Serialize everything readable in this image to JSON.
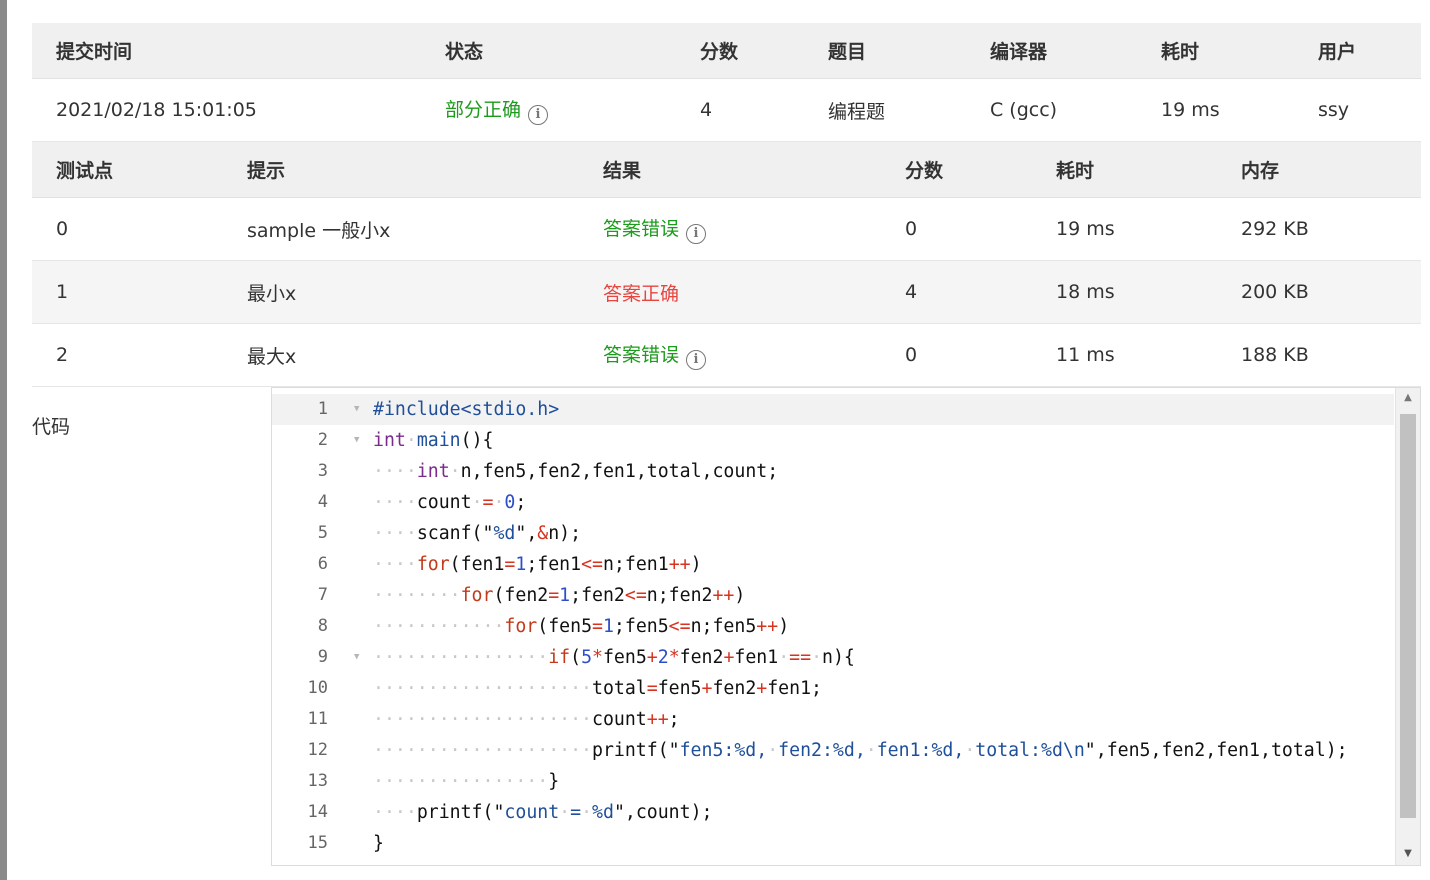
{
  "submission": {
    "headers": [
      "提交时间",
      "状态",
      "分数",
      "题目",
      "编译器",
      "耗时",
      "用户"
    ],
    "row": {
      "time": "2021/02/18 15:01:05",
      "status": "部分正确",
      "score": "4",
      "problem": "编程题",
      "compiler": "C (gcc)",
      "elapsed": "19 ms",
      "user": "ssy"
    }
  },
  "testcases": {
    "headers": [
      "测试点",
      "提示",
      "结果",
      "分数",
      "耗时",
      "内存"
    ],
    "rows": [
      {
        "id": "0",
        "hint": "sample 一般小x",
        "result": "答案错误",
        "score": "0",
        "time": "19 ms",
        "memory": "292 KB"
      },
      {
        "id": "1",
        "hint": "最小x",
        "result": "答案正确",
        "score": "4",
        "time": "18 ms",
        "memory": "200 KB"
      },
      {
        "id": "2",
        "hint": "最大x",
        "result": "答案错误",
        "score": "0",
        "time": "11 ms",
        "memory": "188 KB"
      }
    ]
  },
  "code_label": "代码",
  "code": {
    "line_numbers": [
      "1",
      "2",
      "3",
      "4",
      "5",
      "6",
      "7",
      "8",
      "9",
      "10",
      "11",
      "12",
      "13",
      "14",
      "15"
    ],
    "lines": [
      "#include<stdio.h>",
      "int main(){",
      "    int n,fen5,fen2,fen1,total,count;",
      "    count = 0;",
      "    scanf(\"%d\",&n);",
      "    for(fen1=1;fen1<=n;fen1++)",
      "        for(fen2=1;fen2<=n;fen2++)",
      "            for(fen5=1;fen5<=n;fen5++)",
      "                if(5*fen5+2*fen2+fen1 == n){",
      "                    total=fen5+fen2+fen1;",
      "                    count++;",
      "                    printf(\"fen5:%d, fen2:%d, fen1:%d, total:%d\\n\",fen5,fen2,fen1,total);",
      "                }",
      "    printf(\"count = %d\",count);",
      "}"
    ]
  },
  "colors": {
    "partial": "#1c9b1c",
    "wrong": "#1c9b1c",
    "accepted": "#e64540"
  },
  "icons": {
    "status_info": "info-circle-icon"
  }
}
